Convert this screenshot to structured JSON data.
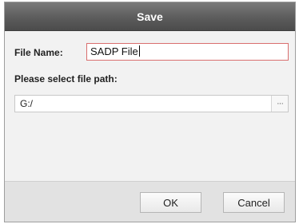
{
  "dialog": {
    "title": "Save",
    "file_name_label": "File Name:",
    "file_name_value": "SADP File",
    "path_label": "Please select file path:",
    "path_value": "G:/",
    "browse_label": "···",
    "ok_label": "OK",
    "cancel_label": "Cancel"
  },
  "colors": {
    "title_bar": "#5c5c5c",
    "focus_border": "#d96f6f"
  }
}
